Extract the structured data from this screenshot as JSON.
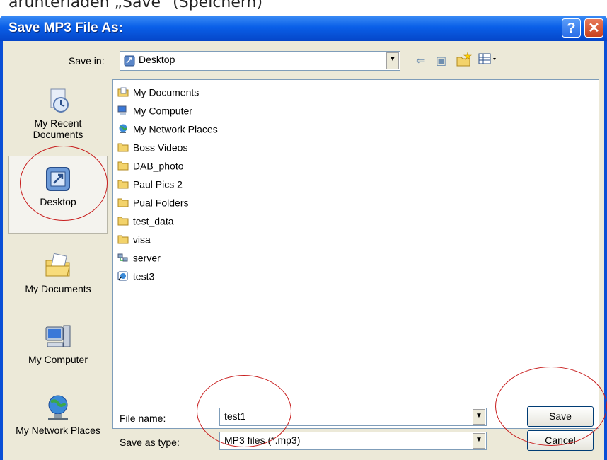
{
  "caption": "arunterladen „Save\" (Speichern)",
  "dialog": {
    "title": "Save MP3 File As:",
    "help_glyph": "?",
    "close_glyph": "✕"
  },
  "save_in": {
    "label": "Save in:",
    "value": "Desktop"
  },
  "places": [
    {
      "label": "My Recent Documents",
      "icon": "recent-documents-icon"
    },
    {
      "label": "Desktop",
      "icon": "desktop-icon",
      "selected": true
    },
    {
      "label": "My Documents",
      "icon": "my-documents-icon"
    },
    {
      "label": "My Computer",
      "icon": "my-computer-icon"
    },
    {
      "label": "My Network Places",
      "icon": "network-places-icon"
    }
  ],
  "files": [
    {
      "name": "My Documents",
      "icon": "my-documents-icon"
    },
    {
      "name": "My Computer",
      "icon": "my-computer-icon"
    },
    {
      "name": "My Network Places",
      "icon": "network-places-icon"
    },
    {
      "name": "Boss Videos",
      "icon": "folder-icon"
    },
    {
      "name": "DAB_photo",
      "icon": "folder-icon"
    },
    {
      "name": "Paul Pics 2",
      "icon": "folder-icon"
    },
    {
      "name": "Pual Folders",
      "icon": "folder-icon"
    },
    {
      "name": "test_data",
      "icon": "folder-icon"
    },
    {
      "name": "visa",
      "icon": "folder-icon"
    },
    {
      "name": "server",
      "icon": "network-drive-icon"
    },
    {
      "name": "test3",
      "icon": "shortcut-icon"
    }
  ],
  "file_name": {
    "label": "File name:",
    "value": "test1"
  },
  "save_as_type": {
    "label": "Save as type:",
    "value": "MP3 files (*.mp3)"
  },
  "buttons": {
    "save": "Save",
    "cancel": "Cancel"
  },
  "colors": {
    "titlebar": "#0a5fe8",
    "annotation": "#c81e1e",
    "dialog_bg": "#ece9d8"
  }
}
